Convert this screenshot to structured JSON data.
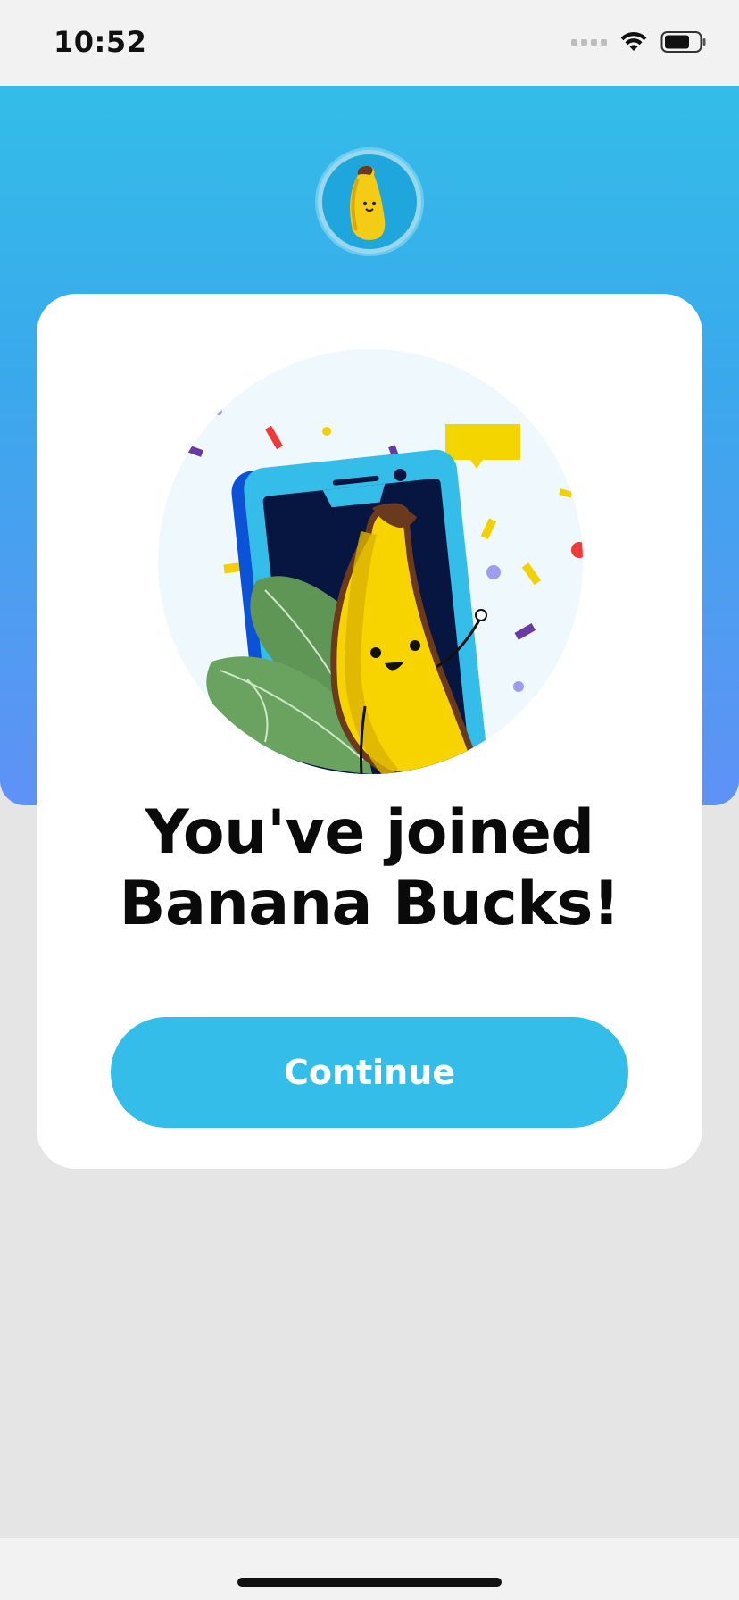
{
  "status_bar": {
    "time": "10:52"
  },
  "header": {
    "avatar_icon": "banana-mascot-icon"
  },
  "card": {
    "illustration_icon": "banana-phone-celebration-illustration",
    "headline_line1": "You've joined",
    "headline_line2": "Banana Bucks!",
    "continue_label": "Continue"
  },
  "colors": {
    "accent": "#33BDE8",
    "gradient_bottom": "#5F92F6",
    "background": "#E5E5E5"
  }
}
